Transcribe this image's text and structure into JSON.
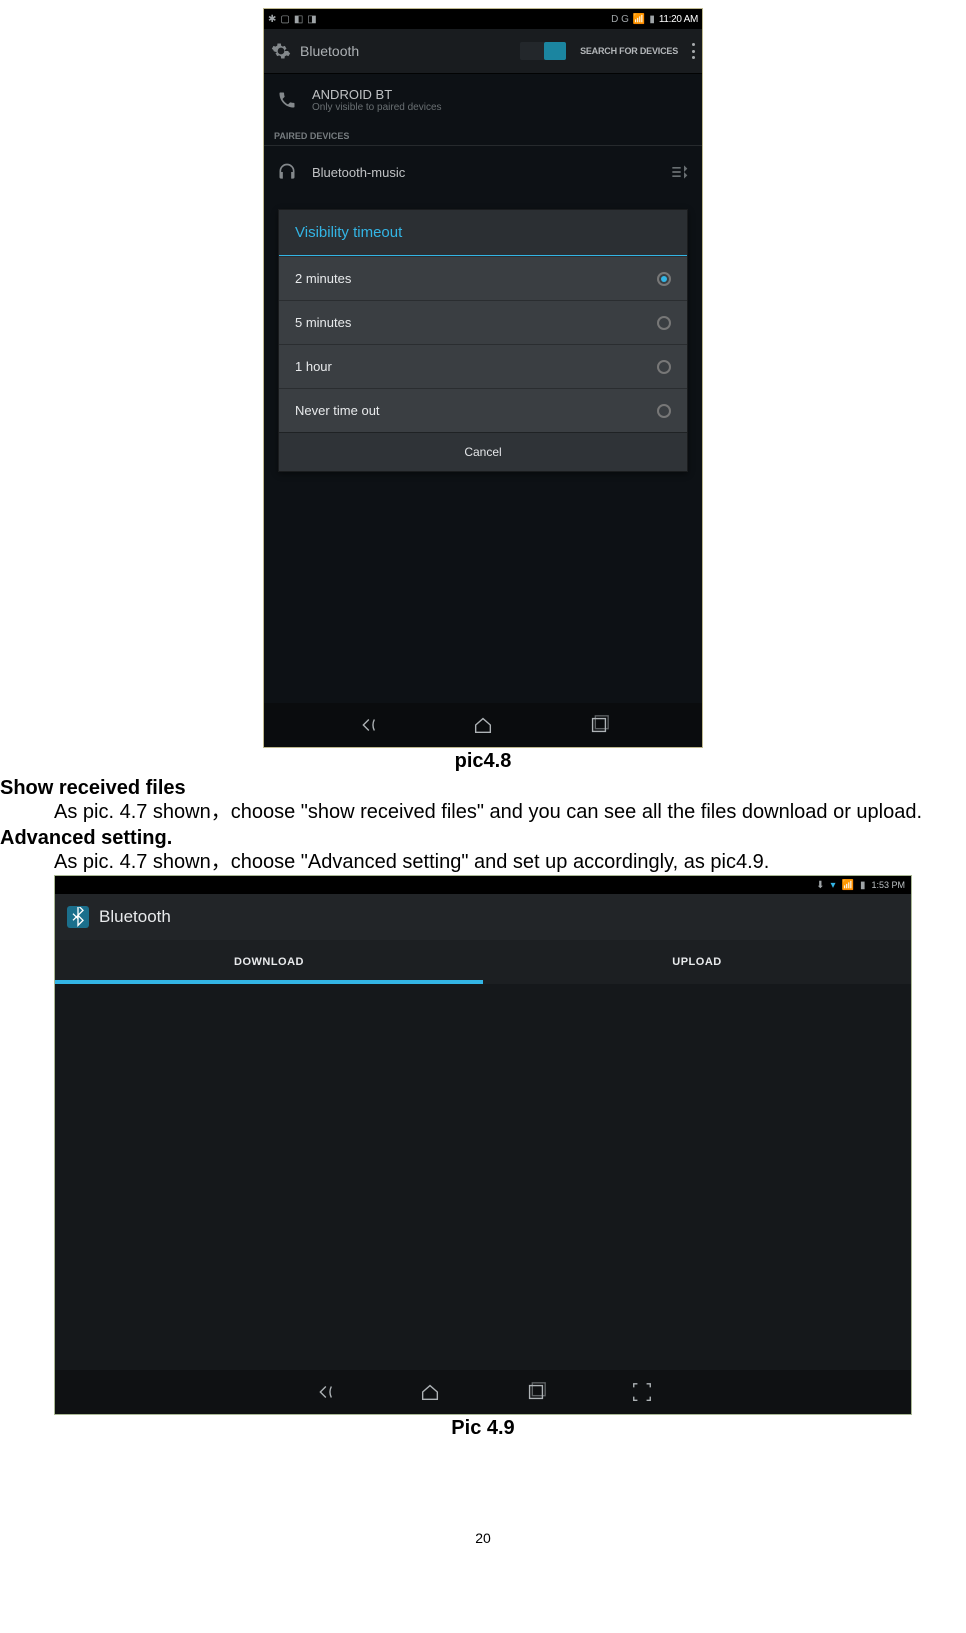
{
  "page": {
    "number": "20"
  },
  "fig1": {
    "caption": "pic4.8",
    "statusbar": {
      "time": "11:20 AM",
      "left_indicators": "B",
      "right_indicators": "D G"
    },
    "header": {
      "title": "Bluetooth",
      "toggle_on": true,
      "search_label": "SEARCH FOR DEVICES"
    },
    "device": {
      "name": "ANDROID BT",
      "subtitle": "Only visible to paired devices"
    },
    "section": "PAIRED DEVICES",
    "paired": {
      "name": "Bluetooth-music"
    },
    "dialog": {
      "title": "Visibility timeout",
      "options": [
        "2 minutes",
        "5 minutes",
        "1 hour",
        "Never time out"
      ],
      "selected_index": 0,
      "cancel": "Cancel"
    }
  },
  "body": {
    "heading1": "Show received files",
    "para1": "As pic. 4.7 shown，choose \"show received files\" and you can see all the files download or upload.",
    "heading2": "Advanced setting.",
    "para2": "As pic. 4.7 shown，choose \"Advanced setting\" and set up accordingly, as pic4.9."
  },
  "fig2": {
    "caption": "Pic 4.9",
    "statusbar": {
      "time": "1:53 PM"
    },
    "header": {
      "title": "Bluetooth"
    },
    "tabs": {
      "download": "DOWNLOAD",
      "upload": "UPLOAD",
      "active": "download"
    }
  }
}
